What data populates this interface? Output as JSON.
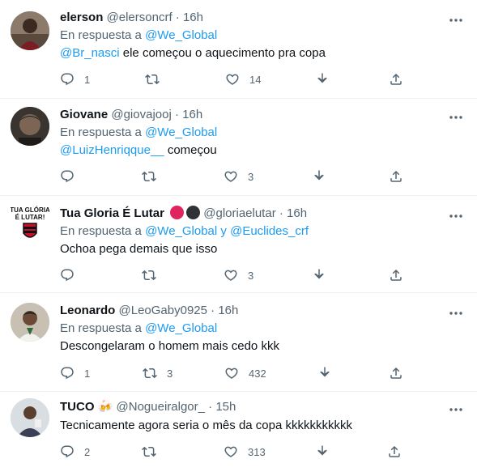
{
  "replying_prefix": "En respuesta a",
  "icons": {
    "reply": "reply-icon",
    "retweet": "retweet-icon",
    "like": "heart-icon",
    "download": "download-icon",
    "share": "share-icon",
    "more": "more-icon"
  },
  "colors": {
    "link": "#1d9bf0",
    "muted": "#536471",
    "divider": "#eff3f4",
    "badge_red": "#e0245e",
    "badge_black": "#2f3336"
  },
  "tweets": [
    {
      "name": "elerson",
      "handle": "@elersoncrf",
      "dot": "·",
      "time": "16h",
      "reply_to": "@We_Global",
      "mention": "@Br_nasci",
      "text": " ele começou o aquecimento pra copa",
      "replies": "1",
      "retweets": "",
      "likes": "14"
    },
    {
      "name": "Giovane",
      "handle": "@giovajooj",
      "dot": "·",
      "time": "16h",
      "reply_to": "@We_Global",
      "mention": "@LuizHenriqque__",
      "text": " começou",
      "replies": "",
      "retweets": "",
      "likes": "3"
    },
    {
      "name": "Tua Gloria É Lutar",
      "handle": "@gloriaelutar",
      "dot": "·",
      "time": "16h",
      "reply_to": "@We_Global",
      "reply_joiner": "y",
      "reply_to_2": "@Euclides_crf",
      "text": "Ochoa pega demais que isso",
      "replies": "",
      "retweets": "",
      "likes": "3",
      "avatar_text": "TUA GLÓRIA É LUTAR!"
    },
    {
      "name": "Leonardo",
      "handle": "@LeoGaby0925",
      "dot": "·",
      "time": "16h",
      "reply_to": "@We_Global",
      "text": "Descongelaram o homem mais cedo kkk",
      "replies": "1",
      "retweets": "3",
      "likes": "432"
    },
    {
      "name": "TUCO",
      "name_emoji": "🍻",
      "handle": "@Nogueiralgor_",
      "dot": "·",
      "time": "15h",
      "text": "Tecnicamente agora seria o mês da copa kkkkkkkkkkk",
      "replies": "2",
      "retweets": "",
      "likes": "313"
    }
  ]
}
